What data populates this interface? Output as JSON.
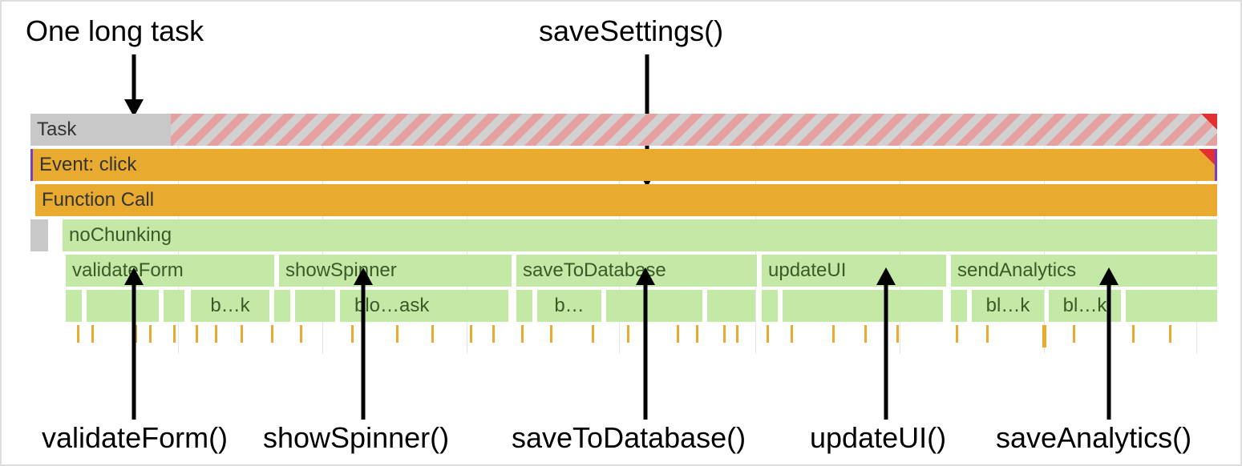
{
  "annotations": {
    "top_left": "One long task",
    "top_right": "saveSettings()",
    "bottom_1": "validateForm()",
    "bottom_2": "showSpinner()",
    "bottom_3": "saveToDatabase()",
    "bottom_4": "updateUI()",
    "bottom_5": "saveAnalytics()"
  },
  "rows": {
    "task": "Task",
    "event": "Event: click",
    "func": "Function Call",
    "noChunking": "noChunking",
    "validateForm": "validateForm",
    "showSpinner": "showSpinner",
    "saveToDatabase": "saveToDatabase",
    "updateUI": "updateUI",
    "sendAnalytics": "sendAnalytics",
    "block1": "b…k",
    "block2": "blo…ask",
    "block3": "b…",
    "block4": "bl…k",
    "block5": "bl…k"
  },
  "colors": {
    "grey": "#c8c8c8",
    "hatch_red": "#e7a0a0",
    "hatch_grey": "#d1d1d1",
    "orange": "#e8aa2f",
    "green": "#c4e8a5",
    "red_tri": "#e03030",
    "purple": "#7a3cc5"
  }
}
